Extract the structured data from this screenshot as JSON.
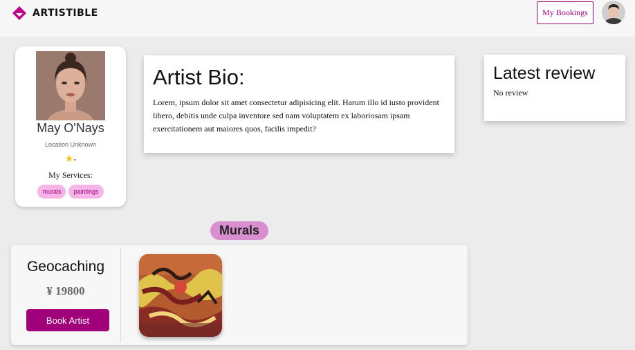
{
  "header": {
    "logo_text": "ARTISTIBLE",
    "logo_icon": "diamond-logo-icon",
    "bookings_label": "My Bookings",
    "avatar_icon": "user-avatar"
  },
  "profile": {
    "name": "May O'Nays",
    "location": "Location Unknown",
    "rating_icon": "star-icon",
    "rating_text": "-",
    "services_label": "My Services:",
    "services": [
      "murals",
      "paintings"
    ]
  },
  "bio": {
    "title": "Artist Bio:",
    "text": "Lorem, ipsum dolor sit amet consectetur adipisicing elit. Harum illo id iusto provident libero, debitis unde culpa inventore sed nam voluptatem ex laboriosam ipsam exercitationem aut maiores quos, facilis impedit?"
  },
  "review": {
    "title": "Latest review",
    "text": "No review"
  },
  "category": {
    "label": "Murals"
  },
  "service": {
    "title": "Geocaching",
    "price": "¥ 19800",
    "book_label": "Book Artist"
  },
  "colors": {
    "brand": "#a0007a",
    "tag_bg": "#f6b4e8",
    "category_bg": "#d98fcf",
    "page_bg": "#ececec"
  }
}
